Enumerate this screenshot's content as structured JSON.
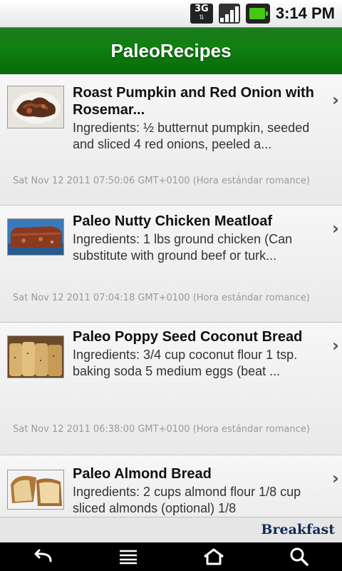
{
  "status_bar": {
    "network_label": "3G",
    "time": "3:14 PM",
    "signal_icon": "signal-icon",
    "battery_icon": "battery-icon"
  },
  "app": {
    "title": "PaleoRecipes"
  },
  "recipes": [
    {
      "title": "Roast Pumpkin and Red Onion with Rosemar...",
      "ingredients": "Ingredients: ½ butternut pumpkin, seeded and sliced 4 red onions, peeled a...",
      "date": "Sat Nov 12 2011 07:50:06 GMT+0100 (Hora estándar romance)"
    },
    {
      "title": "Paleo Nutty Chicken Meatloaf",
      "ingredients": "Ingredients: 1 lbs ground chicken (Can substitute with ground beef or turk...",
      "date": "Sat Nov 12 2011 07:04:18 GMT+0100 (Hora estándar romance)"
    },
    {
      "title": "Paleo Poppy Seed Coconut Bread",
      "ingredients": "Ingredients: 3/4 cup coconut flour 1 tsp. baking soda 5 medium eggs (beat ...",
      "date": "Sat Nov 12 2011 06:38:00 GMT+0100 (Hora estándar romance)"
    },
    {
      "title": "Paleo Almond Bread",
      "ingredients": "Ingredients: 2 cups almond flour 1/8 cup sliced almonds (optional) 1/8",
      "date": ""
    }
  ],
  "footer": {
    "category_label": "Breakfast"
  },
  "nav": {
    "back_icon": "back-arrow-icon",
    "menu_icon": "menu-icon",
    "home_icon": "home-icon",
    "search_icon": "search-icon"
  },
  "colors": {
    "title_bar_green": "#108010",
    "footer_text": "#142c55",
    "date_text": "#9a9a9a"
  }
}
